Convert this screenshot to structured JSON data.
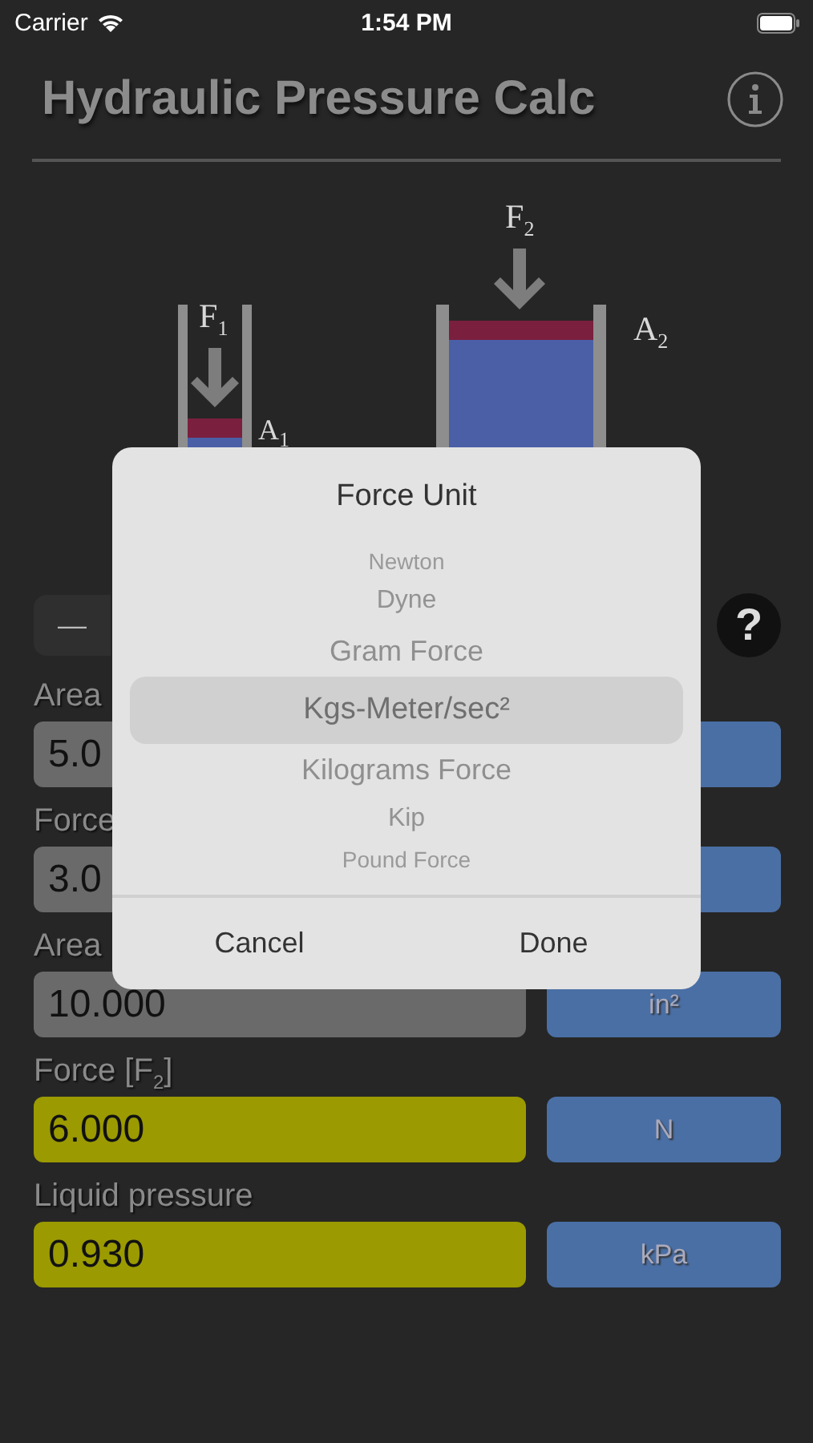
{
  "status_bar": {
    "carrier": "Carrier",
    "time": "1:54 PM"
  },
  "header": {
    "title": "Hydraulic Pressure Calc"
  },
  "diagram": {
    "labels": [
      {
        "kind": "f1",
        "text": "F$_{1}$"
      },
      {
        "kind": "a1",
        "text": "A$_{1}$"
      },
      {
        "kind": "f2",
        "text": "F$_{2}$"
      },
      {
        "kind": "a2",
        "text": "A$_{2}$"
      }
    ]
  },
  "toolbar": {
    "minus": "—",
    "help": "?"
  },
  "rows": [
    {
      "label": "Area",
      "value": "5.0",
      "kind": "input"
    },
    {
      "label": "Force",
      "value": "3.0",
      "kind": "input"
    },
    {
      "label": "Area",
      "value": "10.000",
      "kind": "input",
      "unit": "in²"
    },
    {
      "label": "Force [F$_{2}$]",
      "value": "6.000",
      "kind": "result",
      "unit": "N"
    },
    {
      "label": "Liquid pressure",
      "value": "0.930",
      "kind": "result",
      "unit": "kPa"
    }
  ],
  "dialog": {
    "title": "Force Unit",
    "options": [
      {
        "label": "Newton",
        "selected": false
      },
      {
        "label": "Dyne",
        "selected": false
      },
      {
        "label": "Gram Force",
        "selected": false
      },
      {
        "label": "Kgs-Meter/sec²",
        "selected": true
      },
      {
        "label": "Kilograms Force",
        "selected": false
      },
      {
        "label": "Kip",
        "selected": false
      },
      {
        "label": "Pound Force",
        "selected": false
      }
    ],
    "buttons": [
      "Cancel",
      "Done"
    ]
  }
}
